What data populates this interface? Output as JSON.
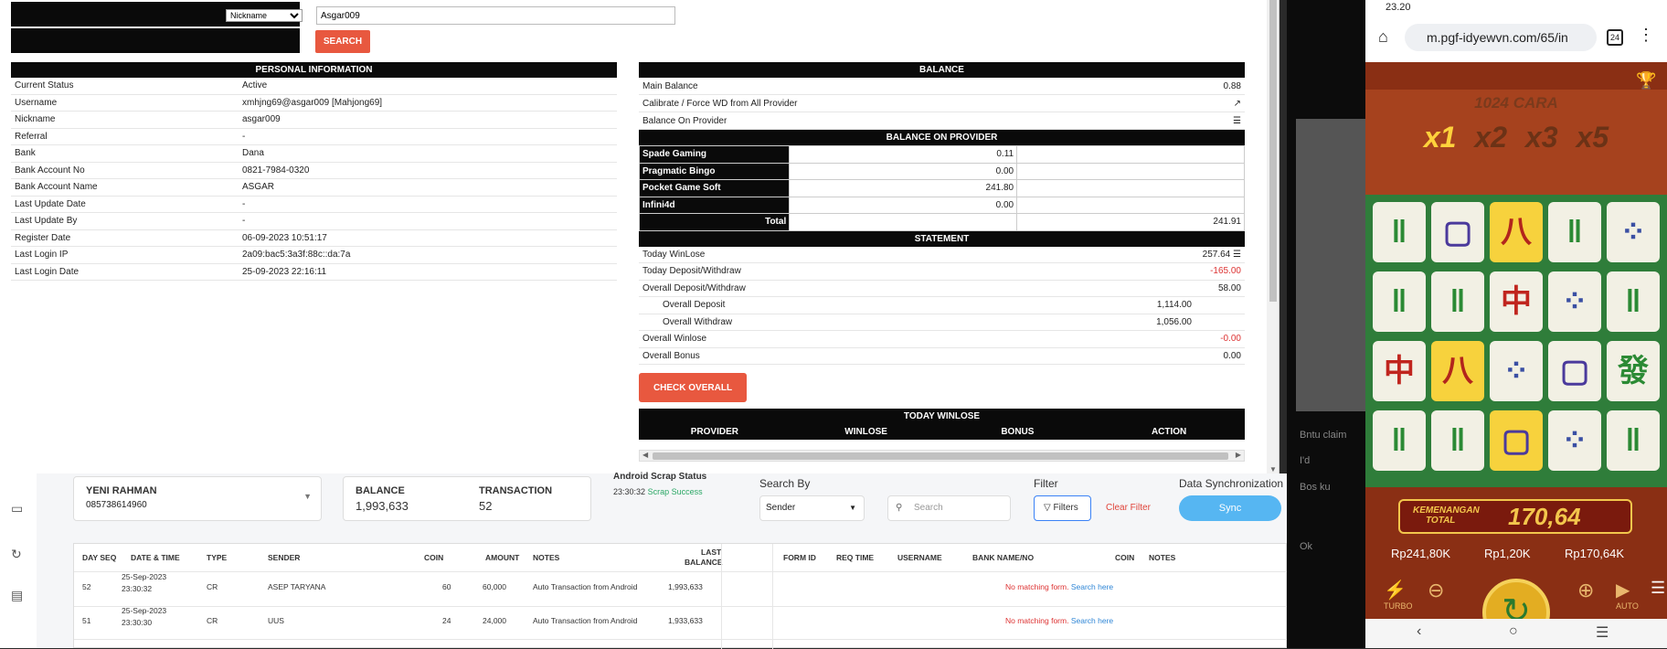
{
  "search": {
    "field_option": "Nickname",
    "value": "Asgar009",
    "button": "SEARCH"
  },
  "personal": {
    "title": "PERSONAL INFORMATION",
    "rows": [
      [
        "Current Status",
        "Active"
      ],
      [
        "Username",
        "xmhjng69@asgar009  [Mahjong69]"
      ],
      [
        "Nickname",
        "asgar009"
      ],
      [
        "Referral",
        "-"
      ],
      [
        "Bank",
        "Dana"
      ],
      [
        "Bank Account No",
        "0821-7984-0320"
      ],
      [
        "Bank Account Name",
        "ASGAR"
      ],
      [
        "Last Update Date",
        "-"
      ],
      [
        "Last Update By",
        "-"
      ],
      [
        "Register Date",
        "06-09-2023 10:51:17"
      ],
      [
        "Last Login IP",
        "2a09:bac5:3a3f:88c::da:7a"
      ],
      [
        "Last Login Date",
        "25-09-2023 22:16:11"
      ]
    ]
  },
  "balance": {
    "title": "BALANCE",
    "main_label": "Main Balance",
    "main_value": "0.88",
    "calibrate_label": "Calibrate / Force WD from All Provider",
    "on_provider_label": "Balance On Provider",
    "provider_title": "BALANCE ON PROVIDER",
    "providers": [
      [
        "Spade Gaming",
        "0.11"
      ],
      [
        "Pragmatic Bingo",
        "0.00"
      ],
      [
        "Pocket Game Soft",
        "241.80"
      ],
      [
        "Infini4d",
        "0.00"
      ]
    ],
    "total_label": "Total",
    "total_value": "241.91"
  },
  "statement": {
    "title": "STATEMENT",
    "rows": [
      [
        "Today WinLose",
        "257.64"
      ],
      [
        "Today Deposit/Withdraw",
        "-165.00"
      ],
      [
        "Overall Deposit/Withdraw",
        "58.00"
      ],
      [
        "Overall Deposit",
        "1,114.00"
      ],
      [
        "Overall Withdraw",
        "1,056.00"
      ],
      [
        "Overall Winlose",
        "-0.00"
      ],
      [
        "Overall Bonus",
        "0.00"
      ]
    ],
    "check_button": "CHECK OVERALL"
  },
  "today_winlose": {
    "title": "TODAY WINLOSE",
    "columns": [
      "PROVIDER",
      "WINLOSE",
      "BONUS",
      "ACTION"
    ]
  },
  "dashboard": {
    "user_name": "YENI RAHMAN",
    "user_phone": "085738614960",
    "balance_label": "BALANCE",
    "balance_value": "1,993,633",
    "transaction_label": "TRANSACTION",
    "transaction_value": "52",
    "scrap_label": "Android Scrap Status",
    "scrap_time": "23:30:32",
    "scrap_status": "Scrap Success",
    "search_by_label": "Search By",
    "search_by_value": "Sender",
    "search_placeholder": "Search",
    "filter_label": "Filter",
    "filters_button": "Filters",
    "clear_filter": "Clear Filter",
    "sync_label": "Data Synchronization",
    "sync_button": "Sync",
    "columns": [
      "DAY SEQ",
      "DATE & TIME",
      "TYPE",
      "SENDER",
      "COIN",
      "AMOUNT",
      "NOTES",
      "LAST",
      "BALANCE",
      "FORM ID",
      "REQ TIME",
      "USERNAME",
      "BANK NAME/NO",
      "COIN",
      "NOTES"
    ],
    "rows": [
      {
        "seq": "52",
        "date": "25-Sep-2023",
        "time": "23:30:32",
        "type": "CR",
        "sender": "ASEP TARYANA",
        "coin": "60",
        "amount": "60,000",
        "notes": "Auto Transaction from Android",
        "balance": "1,993,633"
      },
      {
        "seq": "51",
        "date": "25-Sep-2023",
        "time": "23:30:30",
        "type": "CR",
        "sender": "UUS",
        "coin": "24",
        "amount": "24,000",
        "notes": "Auto Transaction from Android",
        "balance": "1,933,633"
      }
    ],
    "no_match": "No matching form.",
    "search_here": "Search here"
  },
  "phone": {
    "time": "23.20",
    "url": "m.pgf-idyewvn.com/65/in",
    "tabs": "24",
    "cara": "1024 CARA",
    "multipliers": [
      "x1",
      "x2",
      "x3",
      "x5"
    ],
    "win_label_1": "KEMENANGAN",
    "win_label_2": "TOTAL",
    "win_value": "170,64",
    "stat_1": "Rp241,80K",
    "stat_2": "Rp1,20K",
    "stat_3": "Rp170,64K",
    "turbo": "TURBO",
    "auto": "AUTO",
    "peek_1": "Bntu claim",
    "peek_2": "I'd",
    "peek_3": "Bos ku",
    "peek_4": "Ok"
  }
}
